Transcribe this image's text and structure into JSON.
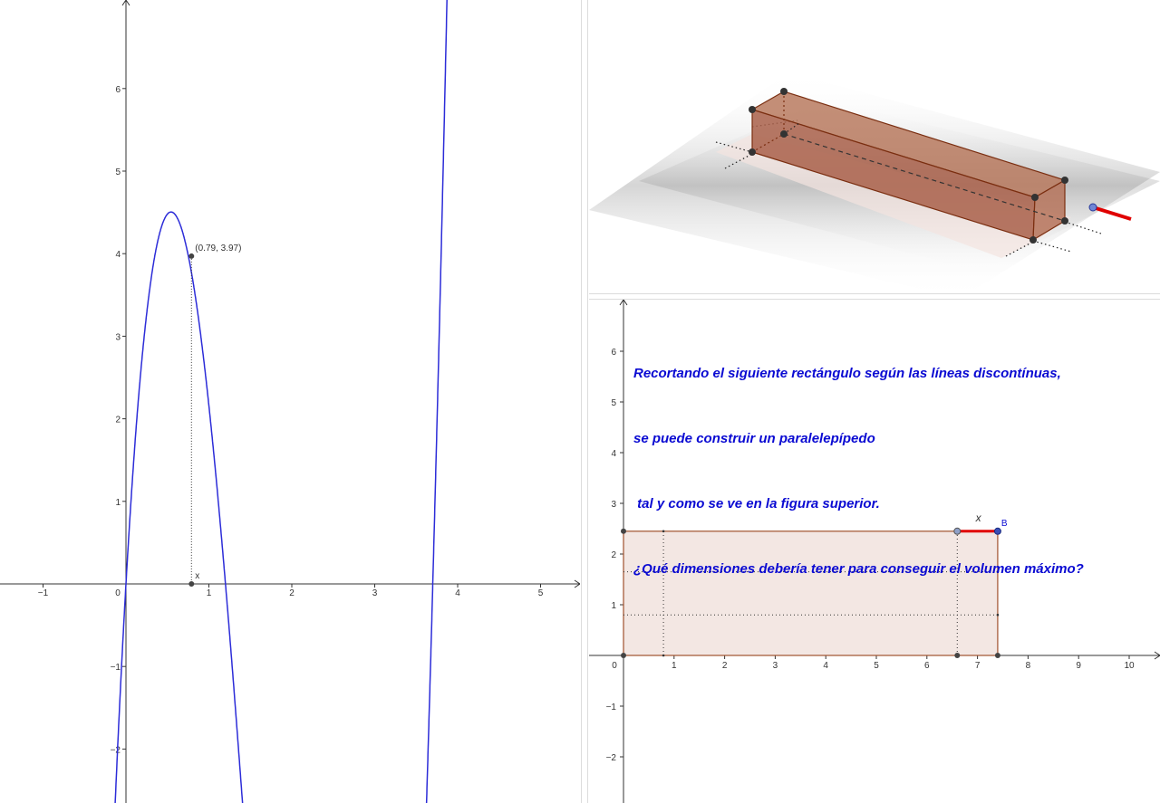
{
  "left_graph": {
    "x_ticks": [
      "−1",
      "0",
      "1",
      "2",
      "3",
      "4",
      "5"
    ],
    "y_ticks": [
      "−2",
      "−1",
      "1",
      "2",
      "3",
      "4",
      "5",
      "6"
    ],
    "point_label": "(0.79, 3.97)",
    "point": {
      "x": 0.79,
      "y": 3.97
    },
    "x_marker_label": "x",
    "curve_color": "#2c2cd8",
    "curve_description": "cubic volume function V(x)"
  },
  "bottom_graph": {
    "x_ticks": [
      "0",
      "1",
      "2",
      "3",
      "4",
      "5",
      "6",
      "7",
      "8",
      "9",
      "10"
    ],
    "y_ticks": [
      "−2",
      "−1",
      "1",
      "2",
      "3",
      "4",
      "5",
      "6"
    ],
    "problem_lines": [
      "Recortando el siguiente rectángulo según las líneas discontínuas,",
      "se puede construir un paralelepípedo",
      " tal y como se ve en la figura superior.",
      "¿Qué dimensiones debería tener para conseguir el volumen máximo?"
    ],
    "text_color": "#0a0ad2",
    "slider_label": "x",
    "point_b_label": "B",
    "rect_fill": "#f3e7e3",
    "rect_stroke": "#a0522d",
    "segment_color": "#e00000"
  },
  "view3d": {
    "box_fill": "#a96a4f",
    "edge_color": "#7a2e10"
  }
}
